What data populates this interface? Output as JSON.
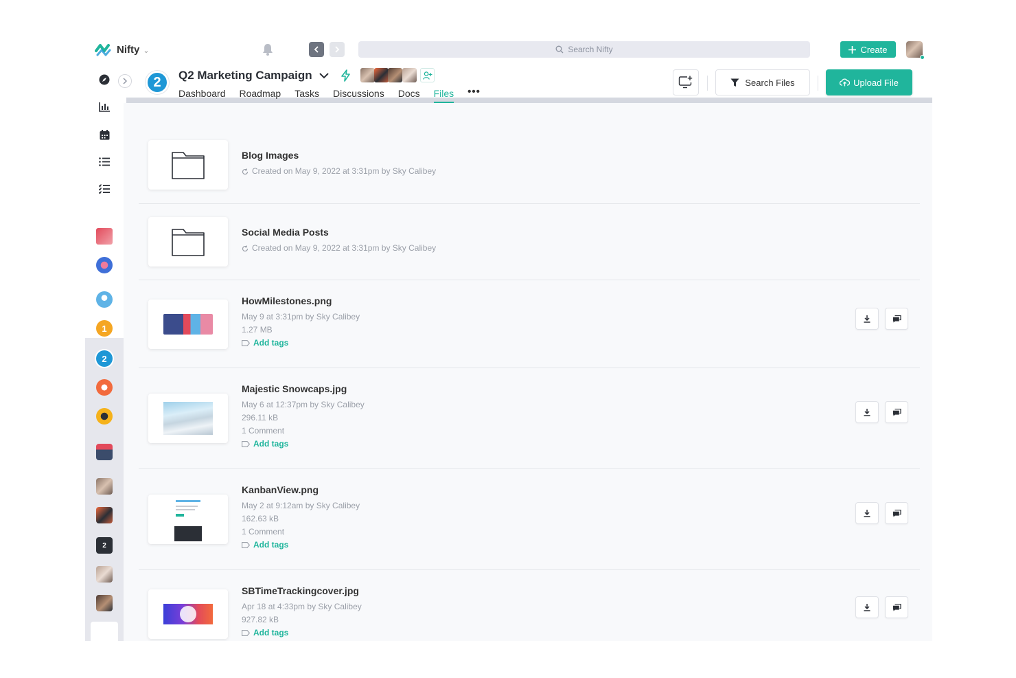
{
  "app": {
    "name": "Nifty"
  },
  "topbar": {
    "search_placeholder": "Search Nifty",
    "create_label": "Create"
  },
  "project": {
    "badge": "2",
    "title": "Q2 Marketing Campaign",
    "tabs": [
      "Dashboard",
      "Roadmap",
      "Tasks",
      "Discussions",
      "Docs",
      "Files"
    ],
    "active_tab": "Files",
    "more": "•••"
  },
  "actions": {
    "search_files_label": "Search Files",
    "upload_label": "Upload File"
  },
  "rail": {
    "projects": [
      "1",
      "2"
    ],
    "dm_badge": "2"
  },
  "folders": [
    {
      "name": "Blog Images",
      "meta": "Created on May 9, 2022 at 3:31pm by Sky Calibey"
    },
    {
      "name": "Social Media Posts",
      "meta": "Created on May 9, 2022 at 3:31pm by Sky Calibey"
    }
  ],
  "files": [
    {
      "name": "HowMilestones.png",
      "date": "May 9 at 3:31pm by Sky Calibey",
      "size": "1.27 MB",
      "comments": "",
      "tags": "Add tags"
    },
    {
      "name": "Majestic Snowcaps.jpg",
      "date": "May 6 at 12:37pm by Sky Calibey",
      "size": "296.11 kB",
      "comments": "1 Comment",
      "tags": "Add tags"
    },
    {
      "name": "KanbanView.png",
      "date": "May 2 at 9:12am by Sky Calibey",
      "size": "162.63 kB",
      "comments": "1 Comment",
      "tags": "Add tags"
    },
    {
      "name": "SBTimeTrackingcover.jpg",
      "date": "Apr 18 at 4:33pm by Sky Calibey",
      "size": "927.82 kB",
      "comments": "",
      "tags": "Add tags"
    }
  ],
  "colors": {
    "accent": "#20b59c",
    "project_blue": "#1e97d6"
  },
  "icons": [
    "logo-icon",
    "bell-icon",
    "search-icon",
    "plus-icon",
    "compass-icon",
    "chart-icon",
    "calendar-icon",
    "list-icon",
    "checklist-icon",
    "folder-icon",
    "refresh-icon",
    "tag-icon",
    "download-icon",
    "comment-icon",
    "filter-icon",
    "upload-cloud-icon",
    "monitor-add-icon",
    "bolt-icon",
    "add-member-icon"
  ]
}
